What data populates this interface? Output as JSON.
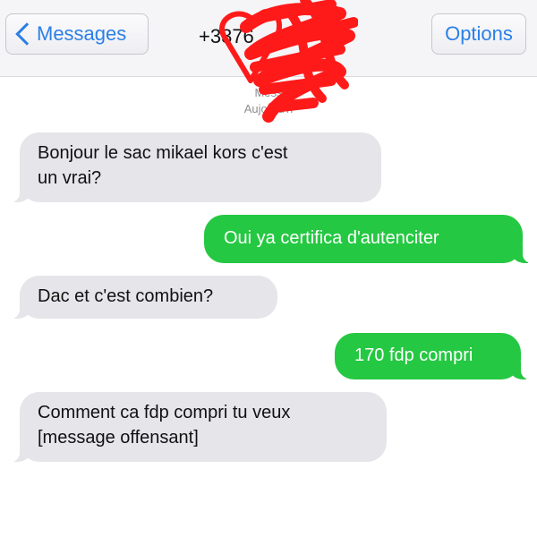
{
  "nav": {
    "back_label": "Messages",
    "title": "+3376",
    "options_label": "Options"
  },
  "timestamps": {
    "line1": "Mess",
    "line2": "Aujourd'h"
  },
  "messages": [
    {
      "direction": "incoming",
      "text": "Bonjour le sac mikael kors c'est\nun vrai?"
    },
    {
      "direction": "outgoing",
      "text": "Oui ya certifica d'autenciter"
    },
    {
      "direction": "incoming",
      "text": "Dac et c'est combien?"
    },
    {
      "direction": "outgoing",
      "text": "170 fdp compri"
    },
    {
      "direction": "incoming",
      "text": "Comment ca fdp compri tu veux\n[message offensant]"
    }
  ],
  "colors": {
    "incoming_bubble": "#e5e5ea",
    "outgoing_bubble": "#25c842",
    "accent": "#2b7fe6",
    "redaction": "#ff1a1a"
  },
  "icons": {
    "back": "chevron-left-icon"
  }
}
